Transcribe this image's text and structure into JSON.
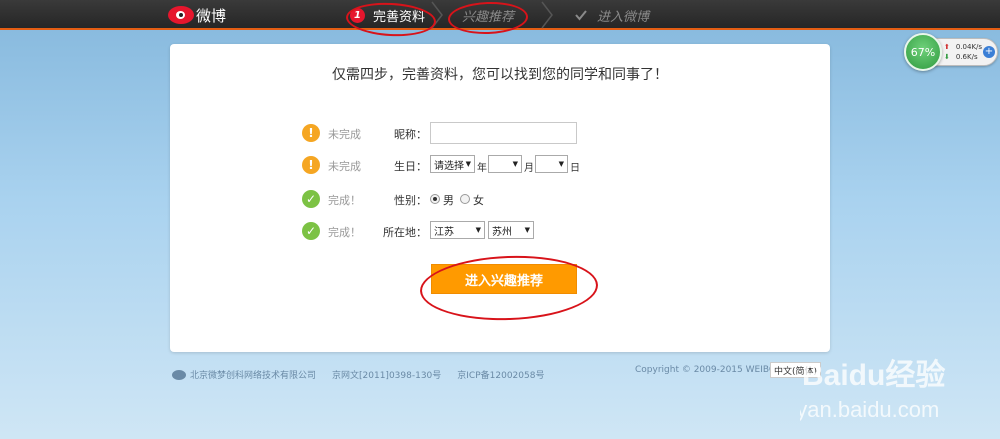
{
  "topbar": {
    "logo_text": "微博",
    "steps": [
      {
        "number": "1",
        "label": "完善资料",
        "state": "active"
      },
      {
        "label": "兴趣推荐",
        "state": "pending"
      },
      {
        "label": "进入微博",
        "state": "pending"
      }
    ]
  },
  "speed_widget": {
    "percent": "67%",
    "upload": "0.04K/s",
    "download": "0.6K/s",
    "plus": "+"
  },
  "card": {
    "headline": "仅需四步，完善资料，您可以找到您的同学和同事了！",
    "rows": [
      {
        "status": "未完成",
        "status_icon": "warning-icon",
        "label": "昵称："
      },
      {
        "status": "未完成",
        "status_icon": "warning-icon",
        "label": "生日：",
        "year_select": "请选择",
        "year_unit": "年",
        "month_select": "",
        "month_unit": "月",
        "day_select": "",
        "day_unit": "日"
      },
      {
        "status": "完成！",
        "status_icon": "check-circle-icon",
        "label": "性别：",
        "option_male": "男",
        "option_female": "女",
        "selected": "男"
      },
      {
        "status": "完成！",
        "status_icon": "check-circle-icon",
        "label": "所在地：",
        "province": "江苏",
        "city": "苏州"
      }
    ],
    "submit_label": "进入兴趣推荐"
  },
  "footer": {
    "company": "北京微梦创科网络技术有限公司",
    "license1": "京网文[2011]0398-130号",
    "license2": "京ICP备12002058号",
    "copyright": "Copyright © 2009-2015 WEIBO",
    "language": "中文(简体)"
  },
  "watermark": {
    "brand": "Baidu经验",
    "url": "jingyan.baidu.com"
  },
  "colors": {
    "accent": "#ff9a00",
    "warning": "#f5a623",
    "success": "#7cc244",
    "annotation_red": "#d8131a",
    "topbar": "#2f2f2f"
  }
}
